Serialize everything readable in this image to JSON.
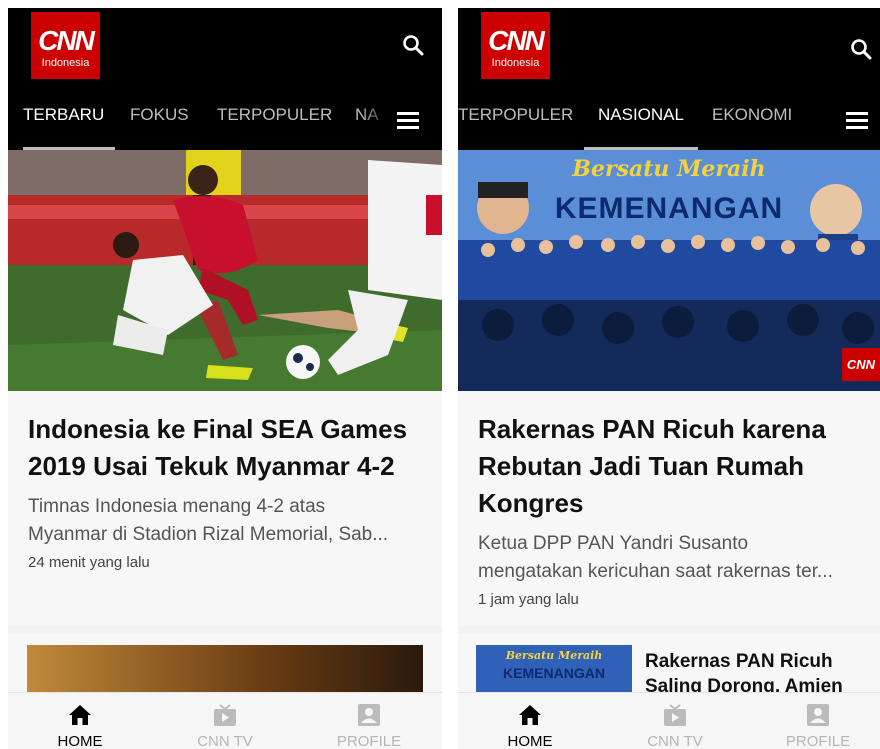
{
  "brand": {
    "logo_main": "CNN",
    "logo_sub": "Indonesia",
    "color": "#cc0000"
  },
  "left": {
    "tabs": [
      {
        "label": "TERBARU",
        "active": true
      },
      {
        "label": "FOKUS",
        "active": false
      },
      {
        "label": "TERPOPULER",
        "active": false
      },
      {
        "label": "NA",
        "active": false
      }
    ],
    "article": {
      "headline": "Indonesia ke Final SEA Games 2019 Usai Tekuk Myanmar 4-2",
      "summary_line1": "Timnas Indonesia menang 4-2 atas",
      "summary_line2": "Myanmar di Stadion Rizal Memorial, Sab...",
      "time": "24 menit yang lalu",
      "image": "football-match-photo"
    }
  },
  "right": {
    "tabs": [
      {
        "label": "TERPOPULER",
        "active": false
      },
      {
        "label": "NASIONAL",
        "active": true
      },
      {
        "label": "EKONOMI",
        "active": false
      }
    ],
    "article": {
      "headline": "Rakernas PAN Ricuh karena Rebutan Jadi Tuan Rumah Kongres",
      "summary_line1": "Ketua DPP PAN Yandri Susanto",
      "summary_line2": "mengatakan kericuhan saat rakernas ter...",
      "time": "1 jam yang lalu",
      "image_banner_script": "Bersatu Meraih",
      "image_banner_title": "KEMENANGAN",
      "image_badge": "CNN"
    },
    "next_article": {
      "title": "Rakernas PAN Ricuh Saling Dorong, Amien",
      "thumb_script": "Bersatu Meraih",
      "thumb_title": "KEMENANGAN"
    }
  },
  "nav": {
    "home": "HOME",
    "tv": "CNN TV",
    "profile": "PROFILE"
  },
  "icons": [
    "search-icon",
    "menu-icon",
    "home-icon",
    "tv-icon",
    "profile-icon"
  ]
}
